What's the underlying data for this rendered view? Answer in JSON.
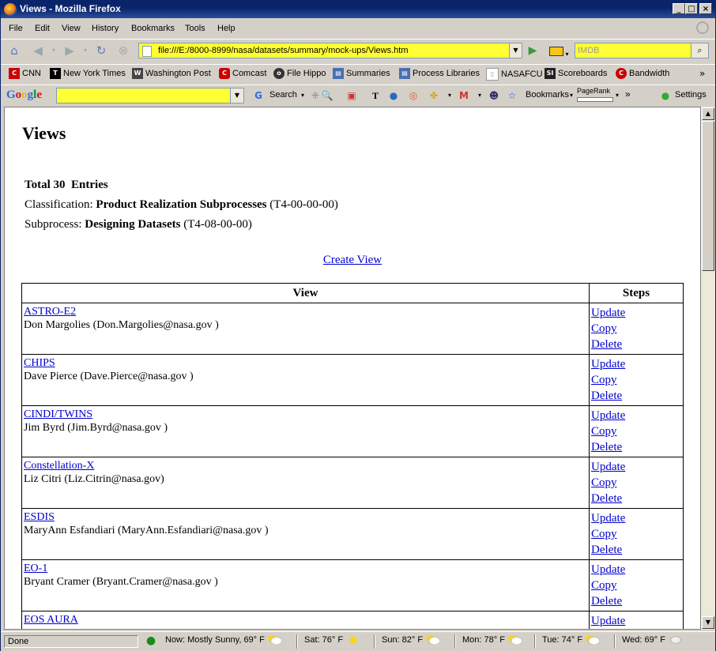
{
  "window": {
    "title": "Views - Mozilla Firefox",
    "min_label": "_",
    "max_label": "□",
    "close_label": "×"
  },
  "menu": [
    "File",
    "Edit",
    "View",
    "History",
    "Bookmarks",
    "Tools",
    "Help"
  ],
  "nav": {
    "url": "file:///E:/8000-8999/nasa/datasets/summary/mock-ups/Views.htm",
    "search_placeholder": "IMDB"
  },
  "bookmarks": [
    {
      "label": "CNN",
      "icon": "cnn-icon",
      "color": "#cc0000"
    },
    {
      "label": "New York Times",
      "icon": "nyt-icon",
      "color": "#000000"
    },
    {
      "label": "Washington Post",
      "icon": "wapo-icon",
      "color": "#444444"
    },
    {
      "label": "Comcast",
      "icon": "comcast-icon",
      "color": "#cc0000"
    },
    {
      "label": "File Hippo",
      "icon": "filehippo-icon",
      "color": "#333333"
    },
    {
      "label": "Summaries",
      "icon": "page-icon",
      "color": "#4a6fb0"
    },
    {
      "label": "Process Libraries",
      "icon": "page-icon",
      "color": "#4a6fb0"
    },
    {
      "label": "NASAFCU",
      "icon": "page-icon",
      "color": "#999999"
    },
    {
      "label": "Scoreboards",
      "icon": "si-icon",
      "color": "#222222"
    },
    {
      "label": "Bandwidth",
      "icon": "bandwidth-icon",
      "color": "#cc0000"
    }
  ],
  "google": {
    "logo": "Google",
    "search_label": "Search",
    "bookmarks_label": "Bookmarks",
    "pagerank_label": "PageRank",
    "settings_label": "Settings"
  },
  "page": {
    "title": "Views",
    "total_prefix": "Total 30",
    "total_suffix": "Entries",
    "classification_label": "Classification:",
    "classification_name": "Product Realization Subprocesses",
    "classification_code": "(T4-00-00-00)",
    "subprocess_label": "Subprocess:",
    "subprocess_name": "Designing Datasets",
    "subprocess_code": "(T4-08-00-00)",
    "create_link": "Create View",
    "col_view": "View",
    "col_steps": "Steps",
    "step_labels": [
      "Update",
      "Copy",
      "Delete"
    ],
    "rows": [
      {
        "name": "ASTRO-E2",
        "contact": "Don Margolies (Don.Margolies@nasa.gov )"
      },
      {
        "name": "CHIPS",
        "contact": "Dave Pierce (Dave.Pierce@nasa.gov )"
      },
      {
        "name": "CINDI/TWINS",
        "contact": "Jim Byrd (Jim.Byrd@nasa.gov )"
      },
      {
        "name": "Constellation-X",
        "contact": "Liz Citri (Liz.Citrin@nasa.gov)"
      },
      {
        "name": "ESDIS",
        "contact": "MaryAnn Esfandiari (MaryAnn.Esfandiari@nasa.gov )"
      },
      {
        "name": "EO-1",
        "contact": "Bryant Cramer (Bryant.Cramer@nasa.gov )"
      },
      {
        "name": "EOS AURA",
        "contact": ""
      }
    ]
  },
  "status": {
    "text": "Done",
    "weather": [
      {
        "label": "Now: Mostly Sunny, 69° F",
        "icon": "partly-sunny-icon"
      },
      {
        "label": "Sat: 76° F",
        "icon": "sunny-icon"
      },
      {
        "label": "Sun: 82° F",
        "icon": "partly-sunny-icon"
      },
      {
        "label": "Mon: 78° F",
        "icon": "partly-sunny-icon"
      },
      {
        "label": "Tue: 74° F",
        "icon": "partly-sunny-icon"
      },
      {
        "label": "Wed: 69° F",
        "icon": "cloudy-icon"
      }
    ]
  }
}
